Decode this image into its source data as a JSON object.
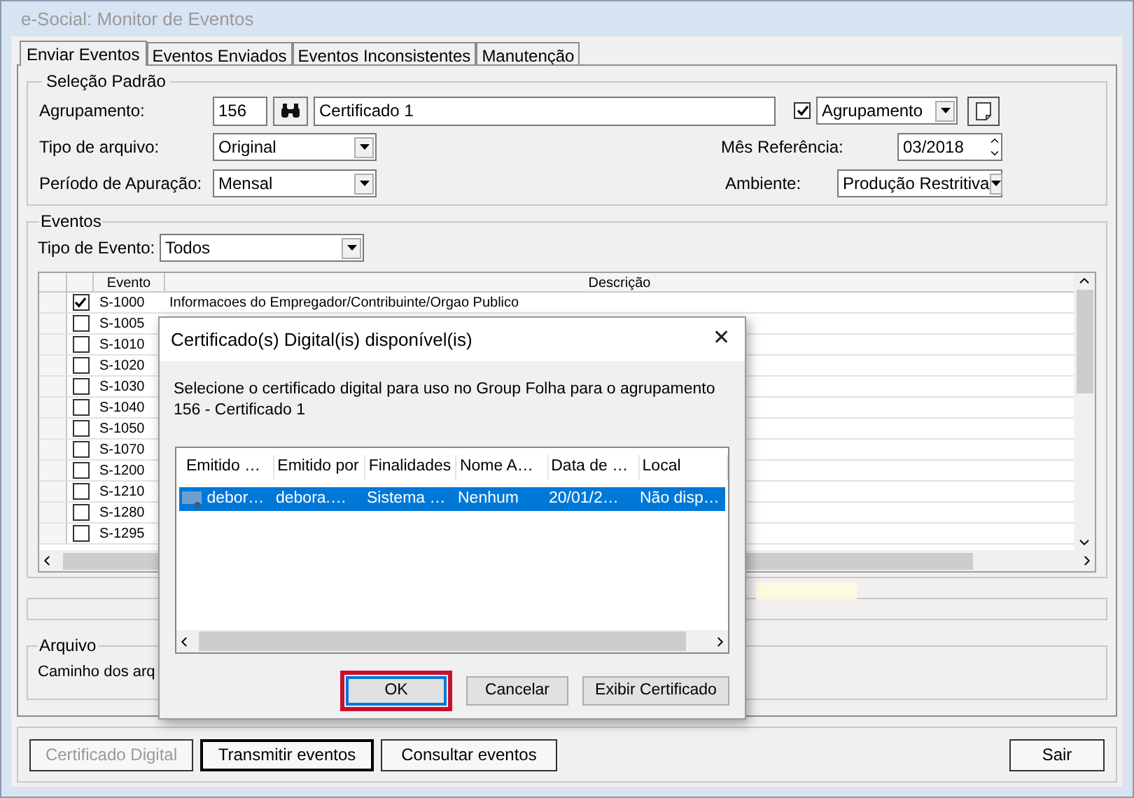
{
  "window": {
    "title": "e-Social: Monitor de Eventos"
  },
  "tabs": [
    {
      "label": "Enviar Eventos",
      "selected": true
    },
    {
      "label": "Eventos Enviados",
      "selected": false
    },
    {
      "label": "Eventos Inconsistentes",
      "selected": false
    },
    {
      "label": "Manutenção",
      "selected": false
    }
  ],
  "selecao_padrao": {
    "title": "Seleção Padrão",
    "agrupamento": {
      "label": "Agrupamento:",
      "code": "156",
      "name": "Certificado 1",
      "checked": true,
      "combo": "Agrupamento"
    },
    "tipo_arquivo": {
      "label": "Tipo de arquivo:",
      "value": "Original"
    },
    "mes_referencia": {
      "label": "Mês Referência:",
      "value": "03/2018"
    },
    "periodo": {
      "label": "Período de Apuração:",
      "value": "Mensal"
    },
    "ambiente": {
      "label": "Ambiente:",
      "value": "Produção Restritiva"
    }
  },
  "eventos": {
    "title": "Eventos",
    "tipo_label": "Tipo de Evento:",
    "tipo_value": "Todos",
    "columns": [
      "Evento",
      "Descrição"
    ],
    "rows": [
      {
        "code": "S-1000",
        "description": "Informacoes do Empregador/Contribuinte/Orgao Publico",
        "checked": true
      },
      {
        "code": "S-1005",
        "checked": false
      },
      {
        "code": "S-1010",
        "checked": false
      },
      {
        "code": "S-1020",
        "checked": false
      },
      {
        "code": "S-1030",
        "checked": false
      },
      {
        "code": "S-1040",
        "checked": false
      },
      {
        "code": "S-1050",
        "checked": false
      },
      {
        "code": "S-1070",
        "checked": false
      },
      {
        "code": "S-1200",
        "checked": false
      },
      {
        "code": "S-1210",
        "checked": false
      },
      {
        "code": "S-1280",
        "checked": false
      },
      {
        "code": "S-1295",
        "checked": false
      }
    ]
  },
  "arquivo": {
    "title": "Arquivo",
    "label": "Caminho dos arq"
  },
  "buttons": [
    {
      "label": "Certificado Digital",
      "disabled": true,
      "default": false
    },
    {
      "label": "Transmitir eventos",
      "disabled": false,
      "default": true
    },
    {
      "label": "Consultar eventos",
      "disabled": false,
      "default": false
    }
  ],
  "exit_button": "Sair",
  "dialog": {
    "title": "Certificado(s) Digital(is) disponível(is)",
    "close": "✕",
    "message": "Selecione o certificado digital para uso no Group Folha para o agrupamento 156 - Certificado 1",
    "columns": [
      "Emitido …",
      "Emitido por",
      "Finalidades",
      "Nome A…",
      "Data de …",
      "Local"
    ],
    "rows": [
      {
        "cells": [
          "debor…",
          "debora.…",
          "Sistema …",
          "Nenhum",
          "20/01/2…",
          "Não disp…"
        ],
        "selected": true
      }
    ],
    "buttons": [
      {
        "label": "OK",
        "highlighted": true
      },
      {
        "label": "Cancelar",
        "highlighted": false
      },
      {
        "label": "Exibir Certificado",
        "highlighted": false
      }
    ]
  }
}
